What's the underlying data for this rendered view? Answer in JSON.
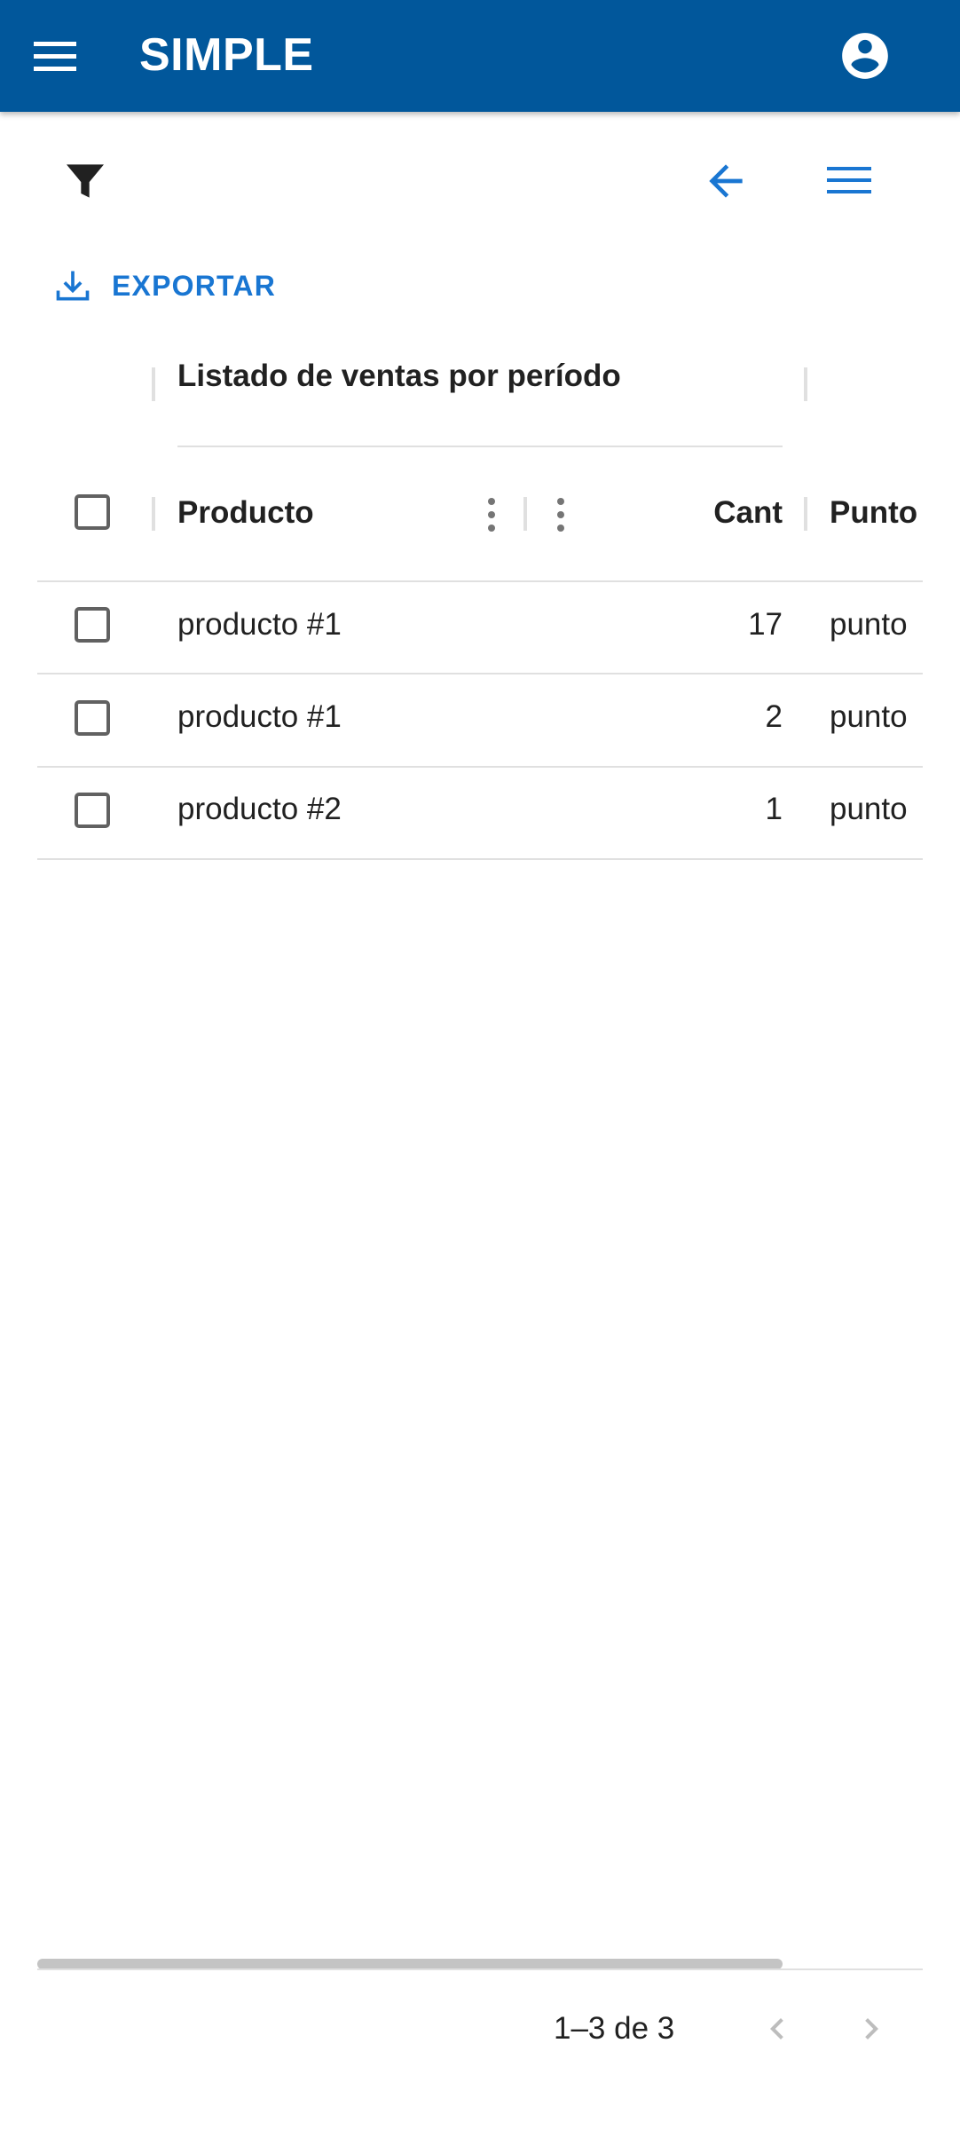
{
  "app": {
    "title": "SIMPLE",
    "primary_color": "#01579b",
    "accent_color": "#1976d2",
    "icons": {
      "menu": "menu-icon",
      "account": "account-circle-icon"
    }
  },
  "toolbar": {
    "icons": {
      "filter": "filter-icon",
      "back": "arrow-back-icon",
      "columns": "menu-lines-icon"
    },
    "export_label": "EXPORTAR"
  },
  "grid": {
    "group_header": "Listado de ventas por período",
    "columns": [
      {
        "label": "Producto"
      },
      {
        "label": "Cant"
      },
      {
        "label": "Punto"
      }
    ],
    "rows": [
      {
        "producto": "producto #1",
        "cant": "17",
        "punto": "punto"
      },
      {
        "producto": "producto #1",
        "cant": "2",
        "punto": "punto"
      },
      {
        "producto": "producto #2",
        "cant": "1",
        "punto": "punto"
      }
    ]
  },
  "pagination": {
    "range_text": "1–3 de 3"
  }
}
